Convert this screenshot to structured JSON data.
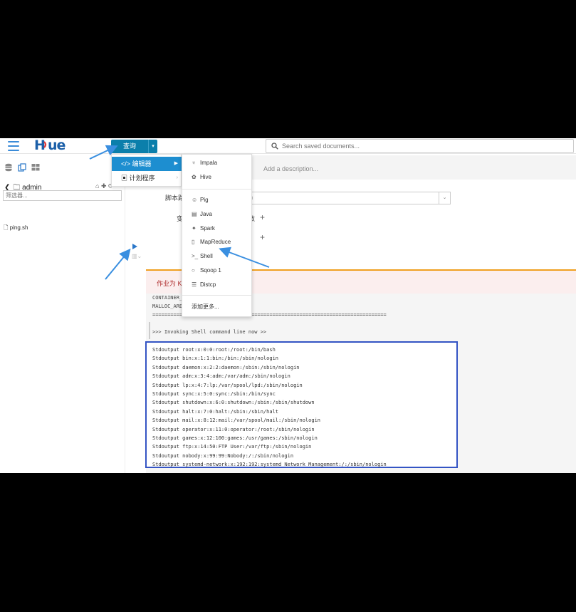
{
  "app": {
    "logo_text": "HUE"
  },
  "header": {
    "query_button": "查询",
    "search_placeholder": "Search saved documents..."
  },
  "left_panel": {
    "folder": "admin",
    "filter_placeholder": "筛选器...",
    "files": [
      "ping.sh"
    ]
  },
  "query_menu": {
    "items": [
      {
        "label": "编辑器",
        "icon": "code-icon",
        "active": true
      },
      {
        "label": "计划程序",
        "icon": "calendar-icon",
        "active": false
      }
    ]
  },
  "editor_menu": {
    "items": [
      {
        "label": "Impala",
        "icon": "impala-icon"
      },
      {
        "label": "Hive",
        "icon": "hive-icon"
      },
      {
        "label": "Pig",
        "icon": "pig-icon"
      },
      {
        "label": "Java",
        "icon": "java-icon"
      },
      {
        "label": "Spark",
        "icon": "spark-icon"
      },
      {
        "label": "MapReduce",
        "icon": "file-icon"
      },
      {
        "label": "Shell",
        "icon": "terminal-icon"
      },
      {
        "label": "Sqoop 1",
        "icon": "circle-icon"
      },
      {
        "label": "Distcp",
        "icon": "database-icon"
      }
    ],
    "more_label": "添加更多..."
  },
  "editor": {
    "description_placeholder": "Add a description...",
    "script_label": "脚本路",
    "script_value": "h",
    "variables_label": "变",
    "variables_text": "数",
    "files_text": "t",
    "job_status": "作业为 KI"
  },
  "log": {
    "pre_lines": [
      "CONTAINER_",
      "MALLOC_ARE",
      "=============================================================================="
    ],
    "invoking_line": ">>> Invoking Shell command line now >>",
    "stdout_lines": [
      "Stdoutput root:x:0:0:root:/root:/bin/bash",
      "Stdoutput bin:x:1:1:bin:/bin:/sbin/nologin",
      "Stdoutput daemon:x:2:2:daemon:/sbin:/sbin/nologin",
      "Stdoutput adm:x:3:4:adm:/var/adm:/sbin/nologin",
      "Stdoutput lp:x:4:7:lp:/var/spool/lpd:/sbin/nologin",
      "Stdoutput sync:x:5:0:sync:/sbin:/bin/sync",
      "Stdoutput shutdown:x:6:0:shutdown:/sbin:/sbin/shutdown",
      "Stdoutput halt:x:7:0:halt:/sbin:/sbin/halt",
      "Stdoutput mail:x:8:12:mail:/var/spool/mail:/sbin/nologin",
      "Stdoutput operator:x:11:0:operator:/root:/sbin/nologin",
      "Stdoutput games:x:12:100:games:/usr/games:/sbin/nologin",
      "Stdoutput ftp:x:14:50:FTP User:/var/ftp:/sbin/nologin",
      "Stdoutput nobody:x:99:99:Nobody:/:/sbin/nologin",
      "Stdoutput systemd-network:x:192:192:systemd Network Management:/:/sbin/nologin"
    ]
  },
  "colors": {
    "accent": "#0b7fab",
    "menu_active": "#1d8ed0",
    "highlight_border": "#3454c4",
    "annotation_arrow": "#3a8fe0",
    "status_line": "#f0a020"
  }
}
